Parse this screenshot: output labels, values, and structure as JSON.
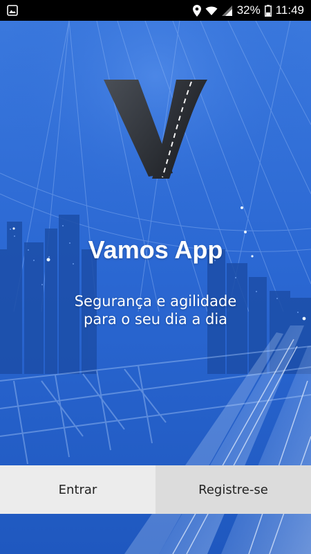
{
  "status_bar": {
    "battery_percent": "32%",
    "time": "11:49",
    "icons": [
      "image-notification-icon",
      "location-icon",
      "wifi-icon",
      "signal-icon",
      "battery-icon"
    ]
  },
  "app": {
    "title": "Vamos App",
    "tagline_line1": "Segurança e agilidade",
    "tagline_line2": "para o seu dia a dia"
  },
  "buttons": {
    "login_label": "Entrar",
    "register_label": "Registre-se"
  },
  "colors": {
    "background_blue": "#2663cf",
    "login_button_bg": "#ececec",
    "register_button_bg": "#dcdcdc"
  }
}
